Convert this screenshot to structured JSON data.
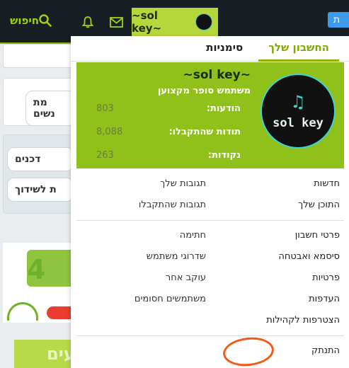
{
  "topbar": {
    "search_label": "חיפוש",
    "username": "~sol key~",
    "right_button_label": "ת"
  },
  "background": {
    "pill_women": "מת נשים",
    "pill_devices": "דכנים",
    "pill_dating": "ת לשידוך",
    "green_banner_text": "יין איזעים"
  },
  "panel": {
    "tabs": [
      {
        "label": "החשבון שלך"
      },
      {
        "label": "סימניות"
      }
    ],
    "profile": {
      "name": "~sol key~",
      "rank": "משתמש סופר מקצוען",
      "stats": [
        {
          "label": "הודעות:",
          "value": "803"
        },
        {
          "label": "תודות שהתקבלו:",
          "value": "8,088"
        },
        {
          "label": "נקודות:",
          "value": "263"
        }
      ],
      "avatar_text": "sol key"
    },
    "menu_group1": [
      {
        "right": "חדשות",
        "left": "תגובות שלך"
      },
      {
        "right": "התוכן שלך",
        "left": "תגובות שהתקבלו"
      }
    ],
    "menu_group2": [
      {
        "right": "פרטי חשבון",
        "left": "חתימה"
      },
      {
        "right": "סיסמא ואבטחה",
        "left": "שדרוגי משתמש"
      },
      {
        "right": "פרטיות",
        "left": "עוקב אחר"
      },
      {
        "right": "העדפות",
        "left": "משתמשים חסומים"
      },
      {
        "right": "הצטרפות לקהילות",
        "left": ""
      }
    ],
    "logout_label": "התנתק"
  },
  "colors": {
    "accent": "#8fb400",
    "profile_bg": "#8fc11a",
    "topbar_bg": "#171f24",
    "annotation": "#f25a16"
  }
}
